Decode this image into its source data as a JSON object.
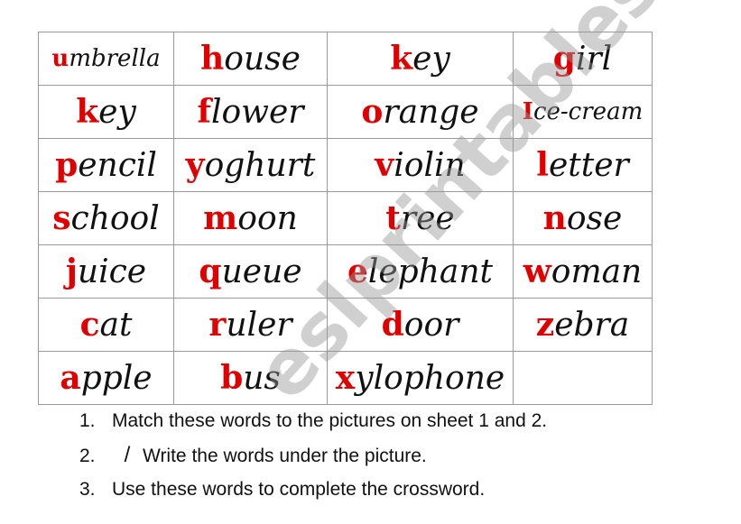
{
  "words": [
    [
      {
        "f": "u",
        "r": "mbrella",
        "small": true
      },
      {
        "f": "h",
        "r": "ouse"
      },
      {
        "f": "k",
        "r": "ey"
      },
      {
        "f": "g",
        "r": "irl"
      }
    ],
    [
      {
        "f": "k",
        "r": "ey"
      },
      {
        "f": "f",
        "r": "lower"
      },
      {
        "f": "o",
        "r": "range"
      },
      {
        "f": "I",
        "r": "ce-cream",
        "small": true
      }
    ],
    [
      {
        "f": "p",
        "r": "encil"
      },
      {
        "f": "y",
        "r": "oghurt"
      },
      {
        "f": "v",
        "r": "iolin"
      },
      {
        "f": "l",
        "r": "etter"
      }
    ],
    [
      {
        "f": "s",
        "r": "chool"
      },
      {
        "f": "m",
        "r": "oon"
      },
      {
        "f": "t",
        "r": "ree"
      },
      {
        "f": "n",
        "r": "ose"
      }
    ],
    [
      {
        "f": "j",
        "r": "uice"
      },
      {
        "f": "q",
        "r": "ueue"
      },
      {
        "f": "e",
        "r": "lephant"
      },
      {
        "f": "w",
        "r": "oman"
      }
    ],
    [
      {
        "f": "c",
        "r": "at"
      },
      {
        "f": "r",
        "r": "uler"
      },
      {
        "f": "d",
        "r": "oor"
      },
      {
        "f": "z",
        "r": "ebra"
      }
    ],
    [
      {
        "f": "a",
        "r": "pple"
      },
      {
        "f": "b",
        "r": "us"
      },
      {
        "f": "x",
        "r": "ylophone"
      },
      {
        "f": "",
        "r": ""
      }
    ]
  ],
  "instructions": [
    {
      "num": "1.",
      "text": "Match these words to the pictures on sheet 1 and 2."
    },
    {
      "num": "2.",
      "mark": "/",
      "text": "Write the words under the picture."
    },
    {
      "num": "3.",
      "text": "Use these words to complete the crossword."
    }
  ],
  "watermark": "eslprintables.com",
  "colors": {
    "first_letter": "#e00000",
    "text": "#111111",
    "border": "#9a9a9a"
  }
}
